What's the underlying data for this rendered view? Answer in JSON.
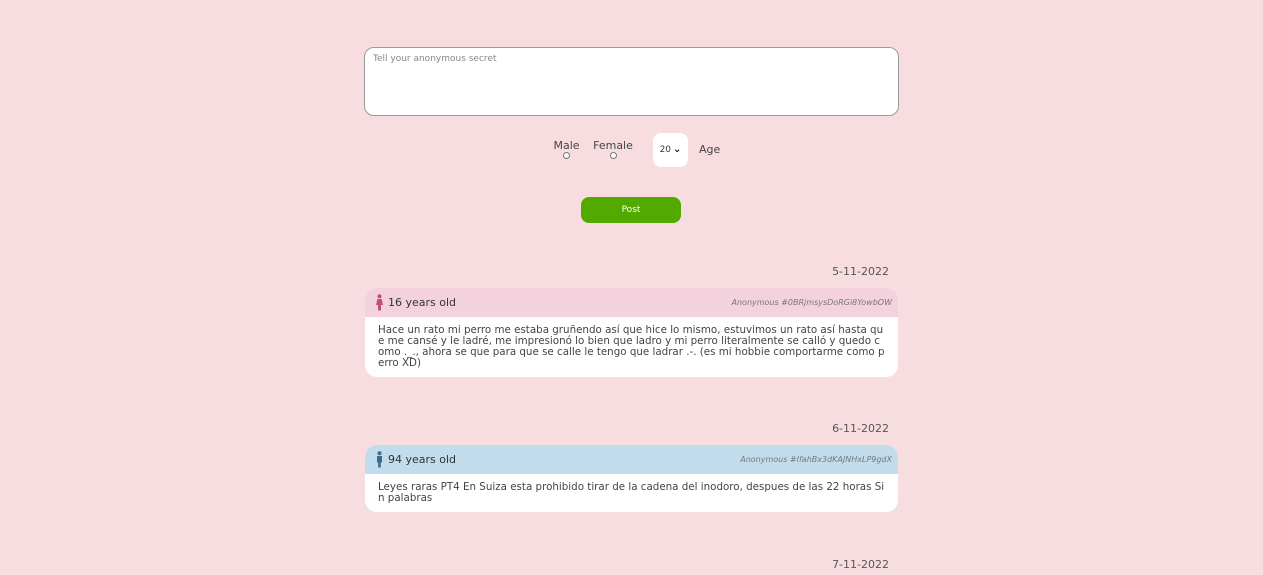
{
  "form": {
    "placeholder": "Tell your anonymous secret",
    "male_label": "Male",
    "female_label": "Female",
    "age_selected": "20",
    "age_label": "Age",
    "post_label": "Post"
  },
  "posts": [
    {
      "date": "5-11-2022",
      "gender": "female",
      "age_text": "16 years old",
      "anon_id": "Anonymous #0BRjmsysDoRGi8YowbOW",
      "body": "Hace un rato mi perro me estaba gruñendo así que hice lo mismo, estuvimos un rato así hasta que me cansé y le ladré, me impresionó lo bien que ladro y mi perro literalmente se calló y quedo como ._., ahora se que para que se calle le tengo que ladrar .-. (es mi hobbie comportarme como perro XD)"
    },
    {
      "date": "6-11-2022",
      "gender": "male",
      "age_text": "94 years old",
      "anon_id": "Anonymous #IfahBx3dKAJNHxLP9gdX",
      "body": "Leyes raras PT4 En Suiza esta prohibido tirar de la cadena del inodoro, despues de las 22 horas Sin palabras"
    },
    {
      "date": "7-11-2022"
    }
  ],
  "colors": {
    "background": "#f8dde0",
    "post_button": "#52a900",
    "female_header": "#f3d2dd",
    "male_header": "#c1dded",
    "female_icon": "#c0506d",
    "male_icon": "#3a6d8e"
  }
}
